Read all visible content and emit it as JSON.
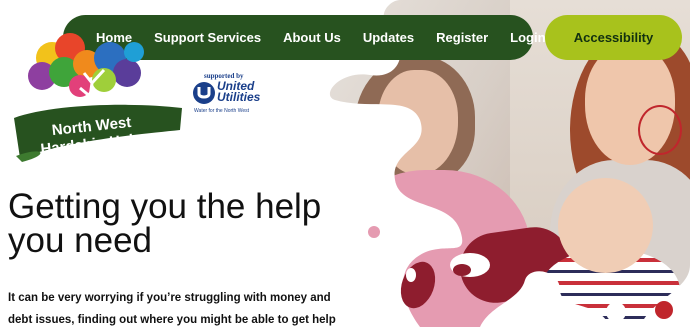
{
  "nav": {
    "items": [
      {
        "label": "Home"
      },
      {
        "label": "Support Services"
      },
      {
        "label": "About Us"
      },
      {
        "label": "Updates"
      },
      {
        "label": "Register"
      },
      {
        "label": "Login"
      }
    ],
    "accessibility_label": "Accessibility"
  },
  "logo": {
    "line1": "North West",
    "line2": "Hardship Hub"
  },
  "sponsor": {
    "supported_by": "supported by",
    "brand_line1": "United",
    "brand_line2": "Utilities",
    "tagline": "Water for the North West"
  },
  "hero": {
    "headline": "Getting you the help you need",
    "intro": "It can be very worrying if you’re struggling with money and debt issues, finding out where you might be able to get help"
  },
  "colors": {
    "nav_bg": "#27521f",
    "accessibility_bg": "#a8c21c",
    "brand_blue": "#1a3f8a"
  }
}
